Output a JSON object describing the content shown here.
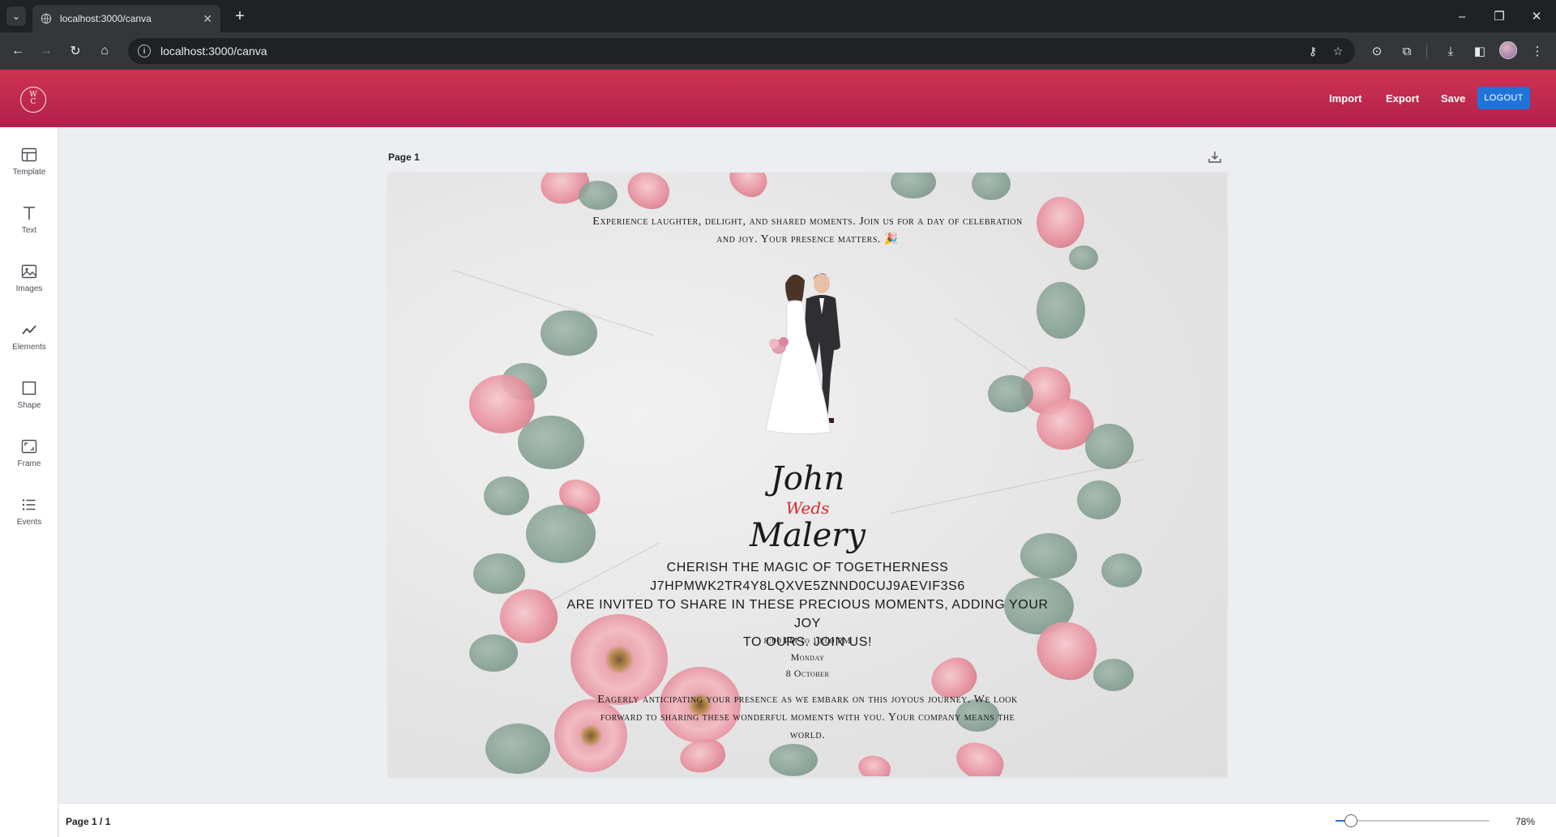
{
  "browser": {
    "tab_title": "localhost:3000/canva",
    "url": "localhost:3000/canva",
    "new_tab_glyph": "+",
    "tab_close_glyph": "✕"
  },
  "header": {
    "logo_text": "W\nC",
    "import_label": "Import",
    "export_label": "Export",
    "save_label": "Save",
    "logout_label": "LOGOUT",
    "gradient_top": "#cf3350",
    "gradient_bottom": "#b2204e",
    "logout_color": "#1e74d8"
  },
  "sidebar": {
    "items": [
      {
        "label": "Template",
        "icon": "template-icon"
      },
      {
        "label": "Text",
        "icon": "text-icon"
      },
      {
        "label": "Images",
        "icon": "image-icon"
      },
      {
        "label": "Elements",
        "icon": "elements-icon"
      },
      {
        "label": "Shape",
        "icon": "shape-icon"
      },
      {
        "label": "Frame",
        "icon": "frame-icon"
      },
      {
        "label": "Events",
        "icon": "events-icon"
      }
    ]
  },
  "workspace": {
    "page_label": "Page 1"
  },
  "invitation": {
    "intro_line1": "Experience laughter, delight, and shared moments. Join us for a day of celebration",
    "intro_line2": "and joy. Your presence matters. 🎉",
    "groom": "John",
    "weds": "Weds",
    "bride": "Malery",
    "cherish": "Cherish the magic of togetherness",
    "code": "J7hpmwk2tr4y8lqxve5znnd0cuj9aevif3s6",
    "invited_line1": "are invited to share in these precious moments, adding your joy",
    "invited_line2": "to ours. Join us!",
    "time": "8:00 PM to 10:00 PM",
    "day": "Monday",
    "date": "8 October",
    "closing_line1": "Eagerly anticipating your presence as we embark on this joyous journey. We look",
    "closing_line2": "forward to sharing these wonderful moments with you. Your company means the",
    "closing_line3": "world.",
    "weds_color": "#d42a2a"
  },
  "footer": {
    "page_count": "Page 1 / 1",
    "zoom_label": "78%",
    "zoom_fraction": 0.1
  }
}
